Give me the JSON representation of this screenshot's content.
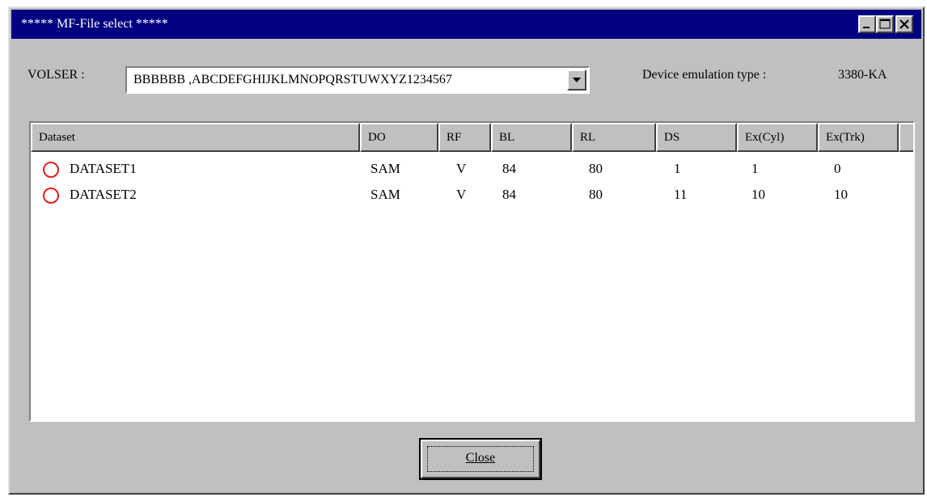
{
  "window": {
    "title": "***** MF-File select *****"
  },
  "title_buttons": {
    "minimize_icon": "minimize-icon",
    "maximize_icon": "maximize-icon",
    "close_icon": "close-icon"
  },
  "volser": {
    "label": "VOLSER :",
    "value": "BBBBBB ,ABCDEFGHIJKLMNOPQRSTUWXYZ1234567"
  },
  "device": {
    "label": "Device emulation type :",
    "value": "3380-KA"
  },
  "table": {
    "columns": [
      "Dataset",
      "DO",
      "RF",
      "BL",
      "RL",
      "DS",
      "Ex(Cyl)",
      "Ex(Trk)"
    ],
    "rows": [
      {
        "name": "DATASET1",
        "do": "SAM",
        "rf": "V",
        "bl": "84",
        "rl": "80",
        "ds": "1",
        "excyl": "1",
        "extrk": "0"
      },
      {
        "name": "DATASET2",
        "do": "SAM",
        "rf": "V",
        "bl": "84",
        "rl": "80",
        "ds": "11",
        "excyl": "10",
        "extrk": "10"
      }
    ]
  },
  "buttons": {
    "close_label": "Close"
  },
  "colors": {
    "titlebar": "#000080",
    "face": "#c0c0c0",
    "status_circle": "#e02020"
  }
}
